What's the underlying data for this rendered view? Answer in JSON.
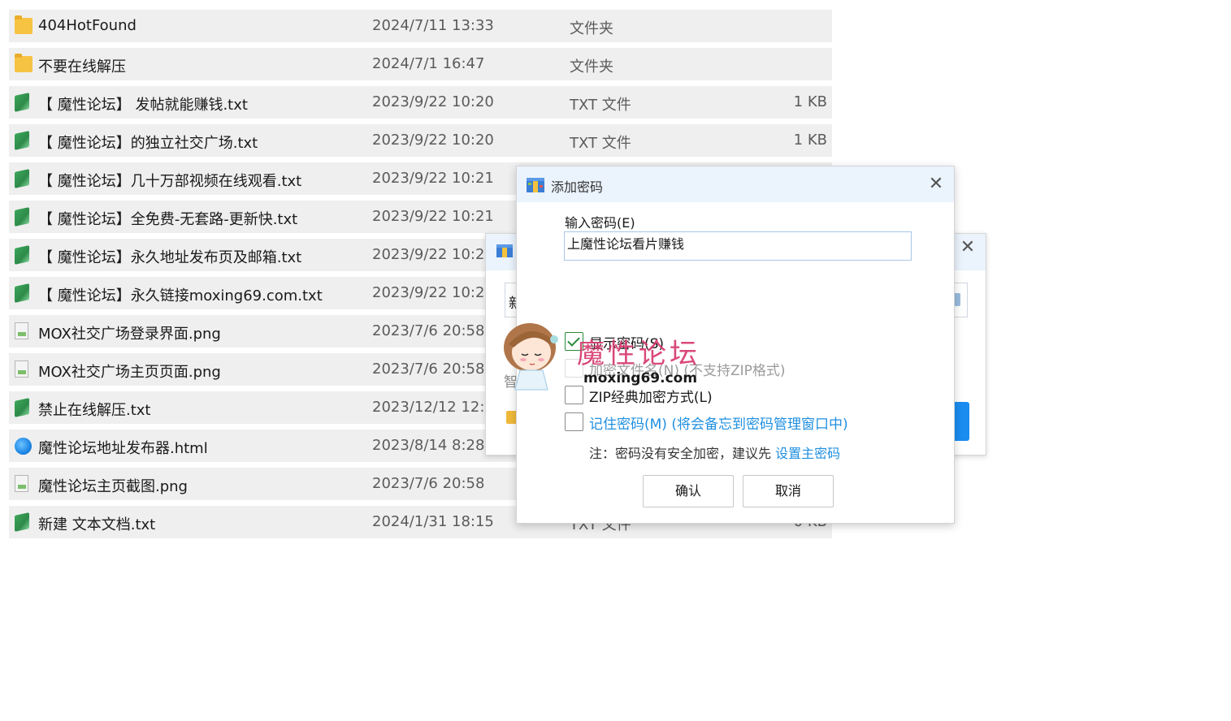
{
  "files": [
    {
      "name": "404HotFound",
      "date": "2024/7/11 13:33",
      "type": "文件夹",
      "size": "",
      "icon": "folder-icon"
    },
    {
      "name": "不要在线解压",
      "date": "2024/7/1 16:47",
      "type": "文件夹",
      "size": "",
      "icon": "folder-icon"
    },
    {
      "name": "【 魔性论坛】 发帖就能赚钱.txt",
      "date": "2023/9/22 10:20",
      "type": "TXT 文件",
      "size": "1 KB",
      "icon": "txt-file-icon"
    },
    {
      "name": "【 魔性论坛】的独立社交广场.txt",
      "date": "2023/9/22 10:20",
      "type": "TXT 文件",
      "size": "1 KB",
      "icon": "txt-file-icon"
    },
    {
      "name": "【 魔性论坛】几十万部视频在线观看.txt",
      "date": "2023/9/22 10:21",
      "type": "",
      "size": "",
      "icon": "txt-file-icon"
    },
    {
      "name": "【 魔性论坛】全免费-无套路-更新快.txt",
      "date": "2023/9/22 10:21",
      "type": "",
      "size": "",
      "icon": "txt-file-icon"
    },
    {
      "name": "【 魔性论坛】永久地址发布页及邮箱.txt",
      "date": "2023/9/22 10:2",
      "type": "",
      "size": "",
      "icon": "txt-file-icon"
    },
    {
      "name": "【 魔性论坛】永久链接moxing69.com.txt",
      "date": "2023/9/22 10:2",
      "type": "",
      "size": "",
      "icon": "txt-file-icon"
    },
    {
      "name": "MOX社交广场登录界面.png",
      "date": "2023/7/6 20:58",
      "type": "",
      "size": "",
      "icon": "png-image-icon"
    },
    {
      "name": "MOX社交广场主页页面.png",
      "date": "2023/7/6 20:58",
      "type": "",
      "size": "",
      "icon": "png-image-icon"
    },
    {
      "name": "禁止在线解压.txt",
      "date": "2023/12/12 12:",
      "type": "",
      "size": "",
      "icon": "txt-file-icon"
    },
    {
      "name": "魔性论坛地址发布器.html",
      "date": "2023/8/14 8:28",
      "type": "",
      "size": "",
      "icon": "html-file-icon"
    },
    {
      "name": "魔性论坛主页截图.png",
      "date": "2023/7/6 20:58",
      "type": "",
      "size": "",
      "icon": "png-image-icon"
    },
    {
      "name": "新建 文本文档.txt",
      "date": "2024/1/31 18:15",
      "type": "TXT 文件",
      "size": "0 KB",
      "icon": "txt-file-icon"
    }
  ],
  "back_dialog": {
    "input_text": "新",
    "hint_text": "智"
  },
  "password_dialog": {
    "title": "添加密码",
    "close_glyph": "✕",
    "input_label": "输入密码(E)",
    "password_value": "上魔性论坛看片赚钱",
    "options": [
      {
        "label": "显示密码(S)",
        "checked": true,
        "disabled": false
      },
      {
        "label": "加密文件名(N) (不支持ZIP格式)",
        "checked": false,
        "disabled": true
      },
      {
        "label": "ZIP经典加密方式(L)",
        "checked": false,
        "disabled": false
      },
      {
        "label": "记住密码(M) (将会备忘到密码管理窗口中)",
        "checked": false,
        "disabled": false
      }
    ],
    "note_prefix": "注：密码没有安全加密，建议先 ",
    "note_link": "设置主密码",
    "ok_label": "确认",
    "cancel_label": "取消"
  },
  "watermark": {
    "text": "魔性论坛",
    "url": "moxing69.com"
  },
  "colors": {
    "row_bg": "#efefef",
    "titlebar_bg": "#ebf3fd",
    "link": "#1f8fe0",
    "accent": "#1a8cf0",
    "watermark": "#d63a6e"
  }
}
